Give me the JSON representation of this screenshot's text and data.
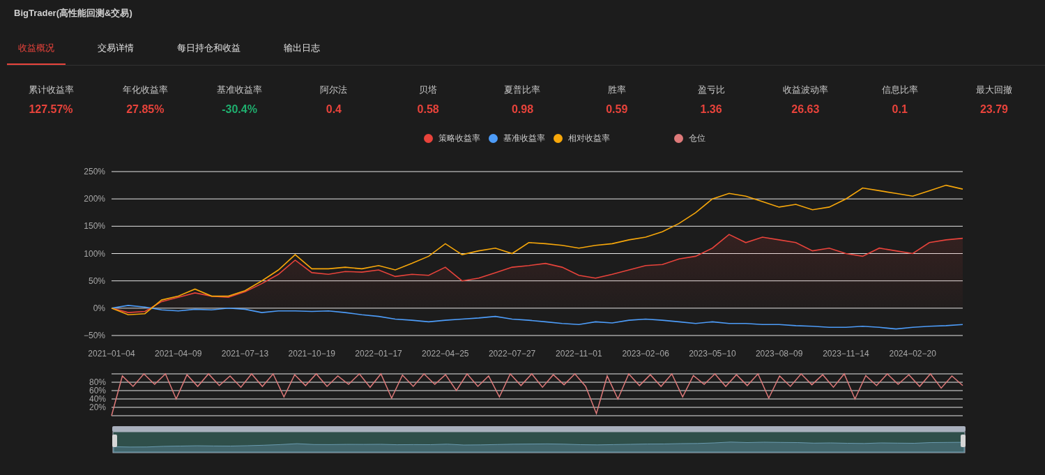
{
  "window": {
    "title": "BigTrader(高性能回测&交易)"
  },
  "tabs": [
    {
      "label": "收益概况",
      "selected": true
    },
    {
      "label": "交易详情",
      "selected": false
    },
    {
      "label": "每日持仓和收益",
      "selected": false
    },
    {
      "label": "输出日志",
      "selected": false
    }
  ],
  "stats": [
    {
      "label": "累计收益率",
      "value": "127.57%",
      "color": "#e8433b"
    },
    {
      "label": "年化收益率",
      "value": "27.85%",
      "color": "#e8433b"
    },
    {
      "label": "基准收益率",
      "value": "-30.4%",
      "color": "#1fae6e"
    },
    {
      "label": "阿尔法",
      "value": "0.4",
      "color": "#e8433b"
    },
    {
      "label": "贝塔",
      "value": "0.58",
      "color": "#e8433b"
    },
    {
      "label": "夏普比率",
      "value": "0.98",
      "color": "#e8433b"
    },
    {
      "label": "胜率",
      "value": "0.59",
      "color": "#e8433b"
    },
    {
      "label": "盈亏比",
      "value": "1.36",
      "color": "#e8433b"
    },
    {
      "label": "收益波动率",
      "value": "26.63",
      "color": "#e8433b"
    },
    {
      "label": "信息比率",
      "value": "0.1",
      "color": "#e8433b"
    },
    {
      "label": "最大回撤",
      "value": "23.79",
      "color": "#e8433b"
    }
  ],
  "returns_chart": {
    "chart_data": {
      "type": "line",
      "grid": true,
      "categories": [
        "2021−01−04",
        null,
        null,
        null,
        "2021−04−09",
        null,
        null,
        null,
        "2021−07−13",
        null,
        null,
        null,
        "2021−10−19",
        null,
        null,
        null,
        "2022−01−17",
        null,
        null,
        null,
        "2022−04−25",
        null,
        null,
        null,
        "2022−07−27",
        null,
        null,
        null,
        "2022−11−01",
        null,
        null,
        null,
        "2023−02−06",
        null,
        null,
        null,
        "2023−05−10",
        null,
        null,
        null,
        "2023−08−09",
        null,
        null,
        null,
        "2023−11−14",
        null,
        null,
        null,
        "2024−02−20",
        null,
        null,
        null
      ],
      "series": [
        {
          "name": "策略收益率",
          "type": "area",
          "color": "#e8433b",
          "values": [
            0,
            -8,
            -6,
            12,
            20,
            28,
            22,
            20,
            30,
            45,
            62,
            88,
            65,
            62,
            67,
            66,
            70,
            58,
            62,
            60,
            75,
            50,
            55,
            65,
            75,
            78,
            82,
            75,
            60,
            55,
            62,
            70,
            78,
            80,
            90,
            95,
            110,
            135,
            120,
            130,
            125,
            120,
            105,
            110,
            100,
            95,
            110,
            105,
            100,
            120,
            125,
            128
          ]
        },
        {
          "name": "基准收益率",
          "type": "line",
          "color": "#4d9cf8",
          "values": [
            0,
            5,
            2,
            -3,
            -5,
            -2,
            -3,
            0,
            -2,
            -8,
            -5,
            -5,
            -6,
            -5,
            -8,
            -12,
            -15,
            -20,
            -22,
            -25,
            -22,
            -20,
            -18,
            -15,
            -20,
            -22,
            -25,
            -28,
            -30,
            -25,
            -27,
            -22,
            -20,
            -22,
            -25,
            -28,
            -25,
            -28,
            -28,
            -30,
            -30,
            -32,
            -33,
            -35,
            -35,
            -33,
            -35,
            -38,
            -35,
            -33,
            -32,
            -30
          ]
        },
        {
          "name": "相对收益率",
          "type": "line",
          "color": "#f7a70a",
          "values": [
            0,
            -12,
            -10,
            15,
            22,
            35,
            22,
            22,
            32,
            50,
            70,
            98,
            72,
            72,
            75,
            72,
            78,
            70,
            82,
            95,
            118,
            98,
            105,
            110,
            100,
            120,
            118,
            115,
            110,
            115,
            118,
            125,
            130,
            140,
            155,
            175,
            200,
            210,
            205,
            195,
            185,
            190,
            180,
            185,
            200,
            220,
            215,
            210,
            205,
            215,
            225,
            218
          ]
        }
      ],
      "ylim": [
        -50,
        250
      ],
      "yticks": [
        {
          "value": -50,
          "label": "−50%"
        },
        {
          "value": 0,
          "label": "0%"
        },
        {
          "value": 50,
          "label": "50%"
        },
        {
          "value": 100,
          "label": "100%"
        },
        {
          "value": 150,
          "label": "150%"
        },
        {
          "value": 200,
          "label": "200%"
        },
        {
          "value": 250,
          "label": "250%"
        }
      ]
    }
  },
  "position_chart": {
    "chart_data": {
      "type": "line",
      "grid": true,
      "series": [
        {
          "name": "仓位",
          "color": "#de7a7a",
          "values": [
            0,
            95,
            70,
            100,
            75,
            100,
            40,
            98,
            70,
            100,
            72,
            95,
            68,
            100,
            70,
            100,
            45,
            98,
            72,
            100,
            70,
            95,
            75,
            100,
            68,
            100,
            42,
            97,
            70,
            100,
            75,
            98,
            60,
            100,
            70,
            95,
            45,
            100,
            72,
            100,
            68,
            98,
            74,
            100,
            70,
            5,
            95,
            40,
            100,
            72,
            98,
            70,
            100,
            45,
            96,
            75,
            100,
            70,
            98,
            72,
            100,
            42,
            95,
            70,
            100,
            74,
            98,
            68,
            100,
            40,
            96,
            72,
            100,
            75,
            98,
            70,
            100,
            66,
            95,
            72
          ]
        }
      ],
      "ylim": [
        0,
        100
      ],
      "yticks": [
        {
          "value": 20,
          "label": "20%"
        },
        {
          "value": 40,
          "label": "40%"
        },
        {
          "value": 60,
          "label": "60%"
        },
        {
          "value": 80,
          "label": "80%"
        }
      ]
    }
  }
}
